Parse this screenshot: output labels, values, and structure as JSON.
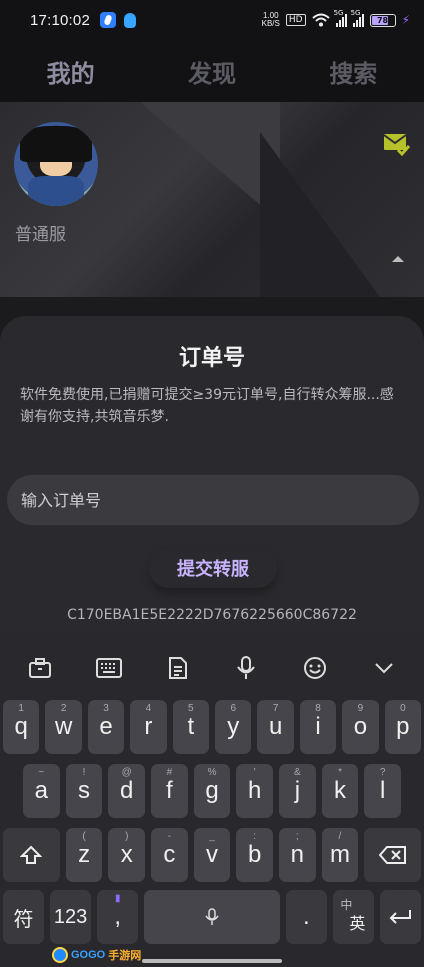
{
  "status_bar": {
    "time": "17:10:02",
    "net_speed_value": "1.00",
    "net_speed_unit": "KB/S",
    "hd_label": "HD",
    "sig1_label": "5G",
    "sig2_label": "5G",
    "battery": "78",
    "battery_level": 0.78,
    "icons": [
      "app-notification-icon",
      "qq-icon",
      "hd-icon",
      "wifi-icon",
      "signal-icon",
      "signal-icon",
      "battery-icon",
      "charging-icon"
    ]
  },
  "tabs": [
    {
      "label": "我的",
      "active": true
    },
    {
      "label": "发现",
      "active": false
    },
    {
      "label": "搜索",
      "active": false
    }
  ],
  "profile": {
    "level": "普通服",
    "mail_icon": "mail-check-icon",
    "expand_icon": "triangle-up-icon"
  },
  "dialog": {
    "title": "订单号",
    "description": "软件免费使用,已捐赠可提交≥39元订单号,自行转众筹服...感谢有你支持,共筑音乐梦.",
    "input_placeholder": "输入订单号",
    "submit_label": "提交转服",
    "device_code": "C170EBA1E5E2222D7676225660C86722",
    "accent_color": "#c9b3ff"
  },
  "keyboard": {
    "toolbar": [
      "toolbox-icon",
      "keyboard-icon",
      "clipboard-icon",
      "microphone-icon",
      "emoji-icon",
      "chevron-down-icon"
    ],
    "row1": [
      {
        "key": "q",
        "hint": "1"
      },
      {
        "key": "w",
        "hint": "2"
      },
      {
        "key": "e",
        "hint": "3"
      },
      {
        "key": "r",
        "hint": "4"
      },
      {
        "key": "t",
        "hint": "5"
      },
      {
        "key": "y",
        "hint": "6"
      },
      {
        "key": "u",
        "hint": "7"
      },
      {
        "key": "i",
        "hint": "8"
      },
      {
        "key": "o",
        "hint": "9"
      },
      {
        "key": "p",
        "hint": "0"
      }
    ],
    "row2": [
      {
        "key": "a",
        "hint": "~"
      },
      {
        "key": "s",
        "hint": "!"
      },
      {
        "key": "d",
        "hint": "@"
      },
      {
        "key": "f",
        "hint": "#"
      },
      {
        "key": "g",
        "hint": "%"
      },
      {
        "key": "h",
        "hint": "'"
      },
      {
        "key": "j",
        "hint": "&"
      },
      {
        "key": "k",
        "hint": "*"
      },
      {
        "key": "l",
        "hint": "?"
      }
    ],
    "row3": [
      {
        "key": "z",
        "hint": "("
      },
      {
        "key": "x",
        "hint": ")"
      },
      {
        "key": "c",
        "hint": "-"
      },
      {
        "key": "v",
        "hint": "_"
      },
      {
        "key": "b",
        "hint": ":"
      },
      {
        "key": "n",
        "hint": ";"
      },
      {
        "key": "m",
        "hint": "/"
      }
    ],
    "shift_icon": "shift-icon",
    "backspace_icon": "backspace-icon",
    "symbol_key": "符",
    "number_key": "123",
    "comma_key": ",",
    "period_key": ".",
    "lang_key_top": "中",
    "lang_key_main": "英",
    "enter_icon": "enter-icon",
    "space_icon": "microphone-icon"
  },
  "watermark": {
    "latin": "GOGO",
    "cn": "手游网"
  }
}
